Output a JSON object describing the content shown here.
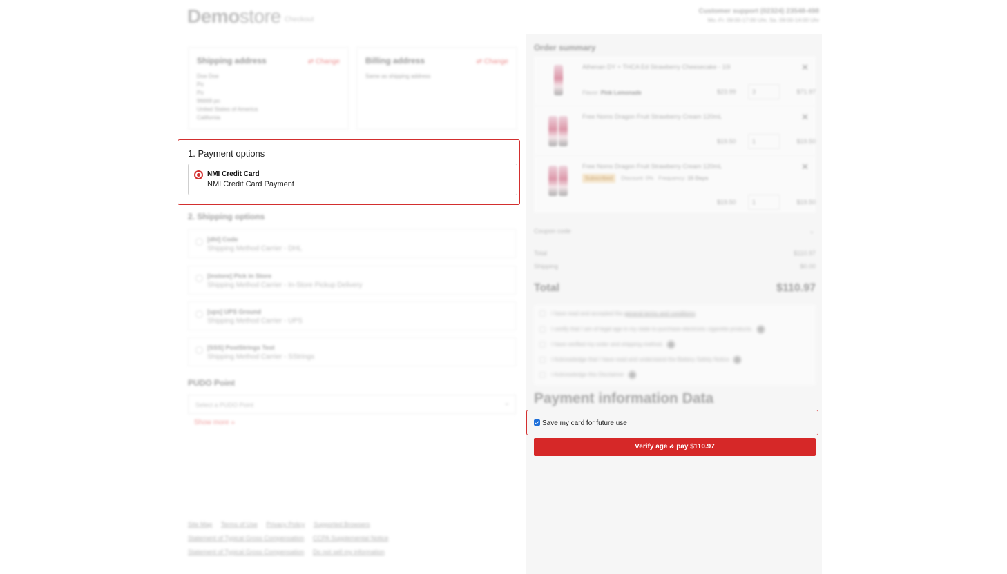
{
  "header": {
    "logo_bold": "Demo",
    "logo_light": "store",
    "logo_sub": "Checkout",
    "support_line1": "Customer support (02324) 23548-498",
    "support_line2": "Mo.-Fr. 09:00-17:00 Uhr, Sa. 09:00-14:00 Uhr"
  },
  "addresses": {
    "shipping": {
      "title": "Shipping address",
      "change": "Change",
      "lines": [
        "Doe Doe",
        "Po",
        "Po",
        "96669 po",
        "United States of America",
        "California"
      ]
    },
    "billing": {
      "title": "Billing address",
      "change": "Change",
      "lines": [
        "Same as shipping address"
      ]
    }
  },
  "payment_options": {
    "title": "1. Payment options",
    "option_title": "NMI Credit Card",
    "option_subtitle": "NMI Credit Card Payment"
  },
  "shipping_options": {
    "title": "2. Shipping options",
    "items": [
      {
        "title": "[dhl] Code",
        "subtitle": "Shipping Method Carrier - DHL"
      },
      {
        "title": "[instore] Pick in Store",
        "subtitle": "Shipping Method Carrier - In-Store Pickup Delivery"
      },
      {
        "title": "[ups] UPS Ground",
        "subtitle": "Shipping Method Carrier - UPS"
      },
      {
        "title": "[SSS] PostStrings Test",
        "subtitle": "Shipping Method Carrier - SStrings"
      }
    ]
  },
  "pudo": {
    "title": "PUDO Point",
    "placeholder": "Select a PUDO Point",
    "show_more": "Show more »"
  },
  "footer": {
    "row1": [
      "Site Map",
      "Terms of Use",
      "Privacy Policy",
      "Supported Browsers"
    ],
    "row2": [
      "Statement of Typical Gross Compensation",
      "CCPA Supplemental Notice"
    ],
    "row3": [
      "Statement of Typical Gross Compensation",
      "Do not sell my information"
    ]
  },
  "order_summary": {
    "title": "Order summary",
    "items": [
      {
        "name": "Athenan DY + THCA Ed Strawberry Cheesecake - 10l",
        "meta_label": "Flavor:",
        "meta_value": "Pink Lemonade",
        "price": "$23.99",
        "qty": "3",
        "total": "$71.97"
      },
      {
        "name": "Free Noms Dragon Fruit Strawberry Cream 120mL",
        "price": "$19.50",
        "qty": "1",
        "total": "$19.50"
      },
      {
        "name": "Free Noms Dragon Fruit Strawberry Cream 120mL",
        "tag": "Subscribed",
        "discount": "Discount: 0%",
        "frequency_label": "Frequency:",
        "frequency_value": "15 Days",
        "price": "$19.50",
        "qty": "1",
        "total": "$19.50"
      }
    ],
    "coupon_label": "Coupon code",
    "subtotal_label": "Total",
    "subtotal_value": "$110.97",
    "shipping_label": "Shipping",
    "shipping_value": "$0.00",
    "total_label": "Total",
    "total_value": "$110.97"
  },
  "terms": {
    "t1_prefix": "I have read and accepted the",
    "t1_link": "general terms and conditions",
    "t2": "I certify that I am of legal age in my state to purchase electronic cigarette products.",
    "t3": "I have verified my order and shipping method.",
    "t4": "I Acknowledge that I have read and understand the Battery Safety Notice",
    "t5": "I Acknowledge this Disclaimer"
  },
  "payment_info": {
    "title": "Payment information Data",
    "save_card_label": "Save my card for future use",
    "save_card_checked": true,
    "pay_button": "Verify age & pay $110.97"
  },
  "colors": {
    "accent_red": "#d62828",
    "checkbox_blue": "#1e6fd9"
  }
}
